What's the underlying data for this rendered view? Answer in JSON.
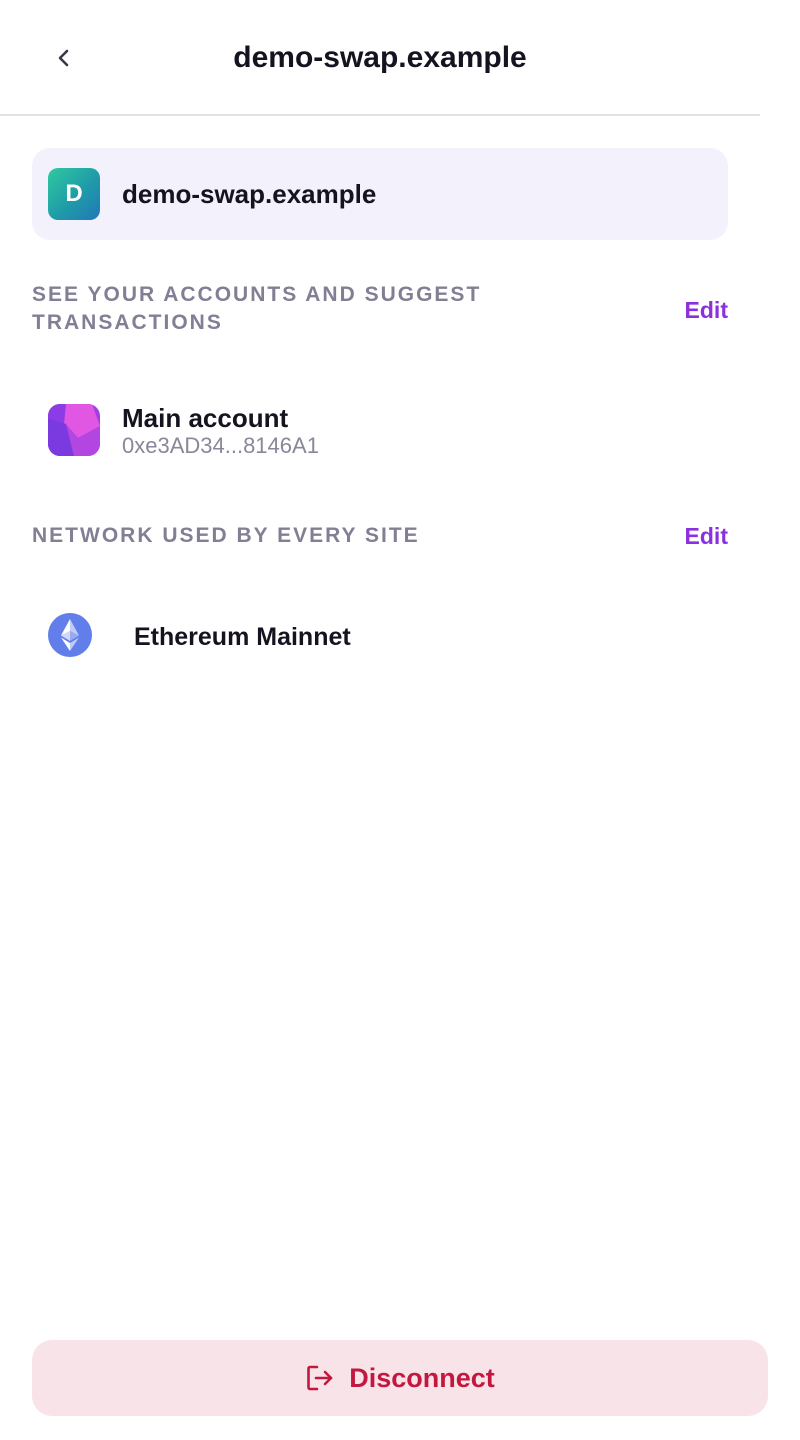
{
  "header": {
    "title": "demo-swap.example",
    "back_icon": "chevron-left-icon"
  },
  "site": {
    "avatar_letter": "D",
    "name": "demo-swap.example"
  },
  "accounts_section": {
    "label": "SEE YOUR ACCOUNTS AND SUGGEST TRANSACTIONS",
    "edit_label": "Edit"
  },
  "account": {
    "name": "Main account",
    "address": "0xe3AD34...8146A1"
  },
  "network_section": {
    "label": "NETWORK USED BY EVERY SITE",
    "edit_label": "Edit"
  },
  "network": {
    "name": "Ethereum Mainnet",
    "icon": "ethereum-icon"
  },
  "footer": {
    "disconnect_label": "Disconnect",
    "disconnect_icon": "logout-icon"
  },
  "colors": {
    "accent": "#8b2fe0",
    "danger": "#c2183f",
    "danger_bg": "#f8e3e8",
    "card_bg": "#f3f2fc",
    "muted": "#827f94"
  }
}
